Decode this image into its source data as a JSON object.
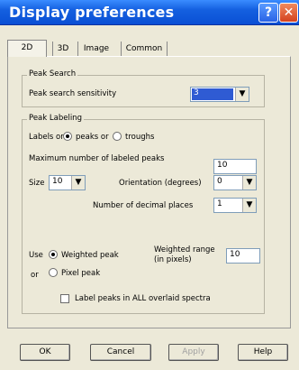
{
  "window": {
    "title": "Display preferences",
    "help_glyph": "?",
    "close_glyph": "✕"
  },
  "tabs": [
    {
      "label": "2D",
      "active": true
    },
    {
      "label": "3D",
      "active": false
    },
    {
      "label": "Image",
      "active": false
    },
    {
      "label": "Common",
      "active": false
    }
  ],
  "peak_search": {
    "legend": "Peak Search",
    "sensitivity_label": "Peak search sensitivity",
    "sensitivity_value": "3",
    "highlight_color": "#2f5bd3"
  },
  "peak_labeling": {
    "legend": "Peak Labeling",
    "labels_on_label": "Labels on",
    "peaks_or_label": "peaks or",
    "troughs_label": "troughs",
    "labels_on_selected": "peaks",
    "max_labeled_label": "Maximum number of labeled peaks",
    "max_labeled_value": "10",
    "size_label": "Size",
    "size_value": "10",
    "orientation_label": "Orientation (degrees)",
    "orientation_value": "0",
    "decimal_places_label": "Number of decimal places",
    "decimal_places_value": "1",
    "use_label": "Use",
    "weighted_peak_label": "Weighted peak",
    "or_label": "or",
    "pixel_peak_label": "Pixel peak",
    "use_selected": "weighted",
    "weighted_range_label_1": "Weighted range",
    "weighted_range_label_2": "(in pixels)",
    "weighted_range_value": "10",
    "label_all_overlaid_label": "Label peaks in ALL overlaid spectra",
    "label_all_overlaid_checked": false
  },
  "buttons": {
    "ok": "OK",
    "cancel": "Cancel",
    "apply": "Apply",
    "help": "Help"
  }
}
